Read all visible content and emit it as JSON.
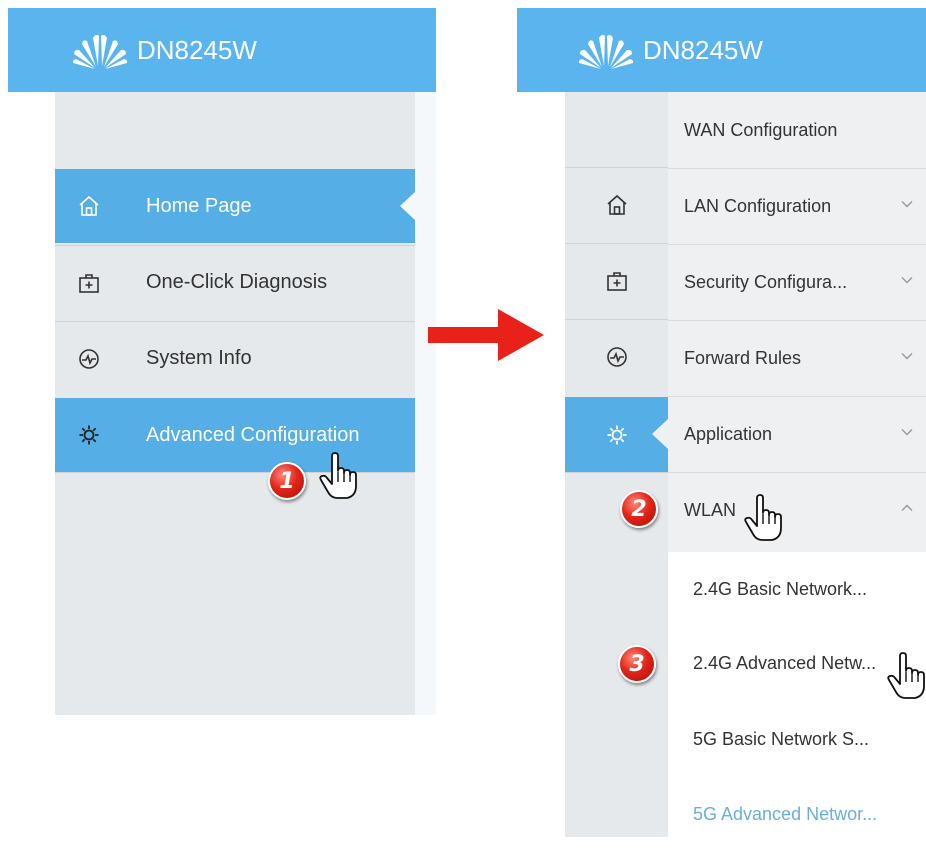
{
  "header": {
    "app_title": "DN8245W",
    "brand_color": "#5ab4ee",
    "logo_icon": "huawei-logo-icon"
  },
  "left_menu": {
    "items": [
      {
        "label": "Home Page",
        "icon": "home-icon",
        "active": true
      },
      {
        "label": "One-Click Diagnosis",
        "icon": "diagnosis-icon",
        "active": false
      },
      {
        "label": "System Info",
        "icon": "system-info-icon",
        "active": false
      },
      {
        "label": "Advanced Configuration",
        "icon": "gear-icon",
        "active": true
      }
    ]
  },
  "right_menu": {
    "items": [
      {
        "label": "WAN Configuration",
        "expanded": null
      },
      {
        "label": "LAN Configuration",
        "expanded": false
      },
      {
        "label": "Security Configura...",
        "expanded": false
      },
      {
        "label": "Forward Rules",
        "expanded": false
      },
      {
        "label": "Application",
        "expanded": false
      },
      {
        "label": "WLAN",
        "expanded": true
      }
    ],
    "wlan_sub_items": [
      {
        "label": "2.4G Basic Network..."
      },
      {
        "label": "2.4G Advanced Netw..."
      },
      {
        "label": "5G Basic Network S..."
      },
      {
        "label": "5G Advanced Networ..."
      }
    ]
  },
  "steps": {
    "step1": "1",
    "step2": "2",
    "step3": "3"
  },
  "colors": {
    "active_item": "#55aee6",
    "panel_bg": "#e6e9ec",
    "arrow": "#e8211a",
    "link": "#6aaee0"
  }
}
